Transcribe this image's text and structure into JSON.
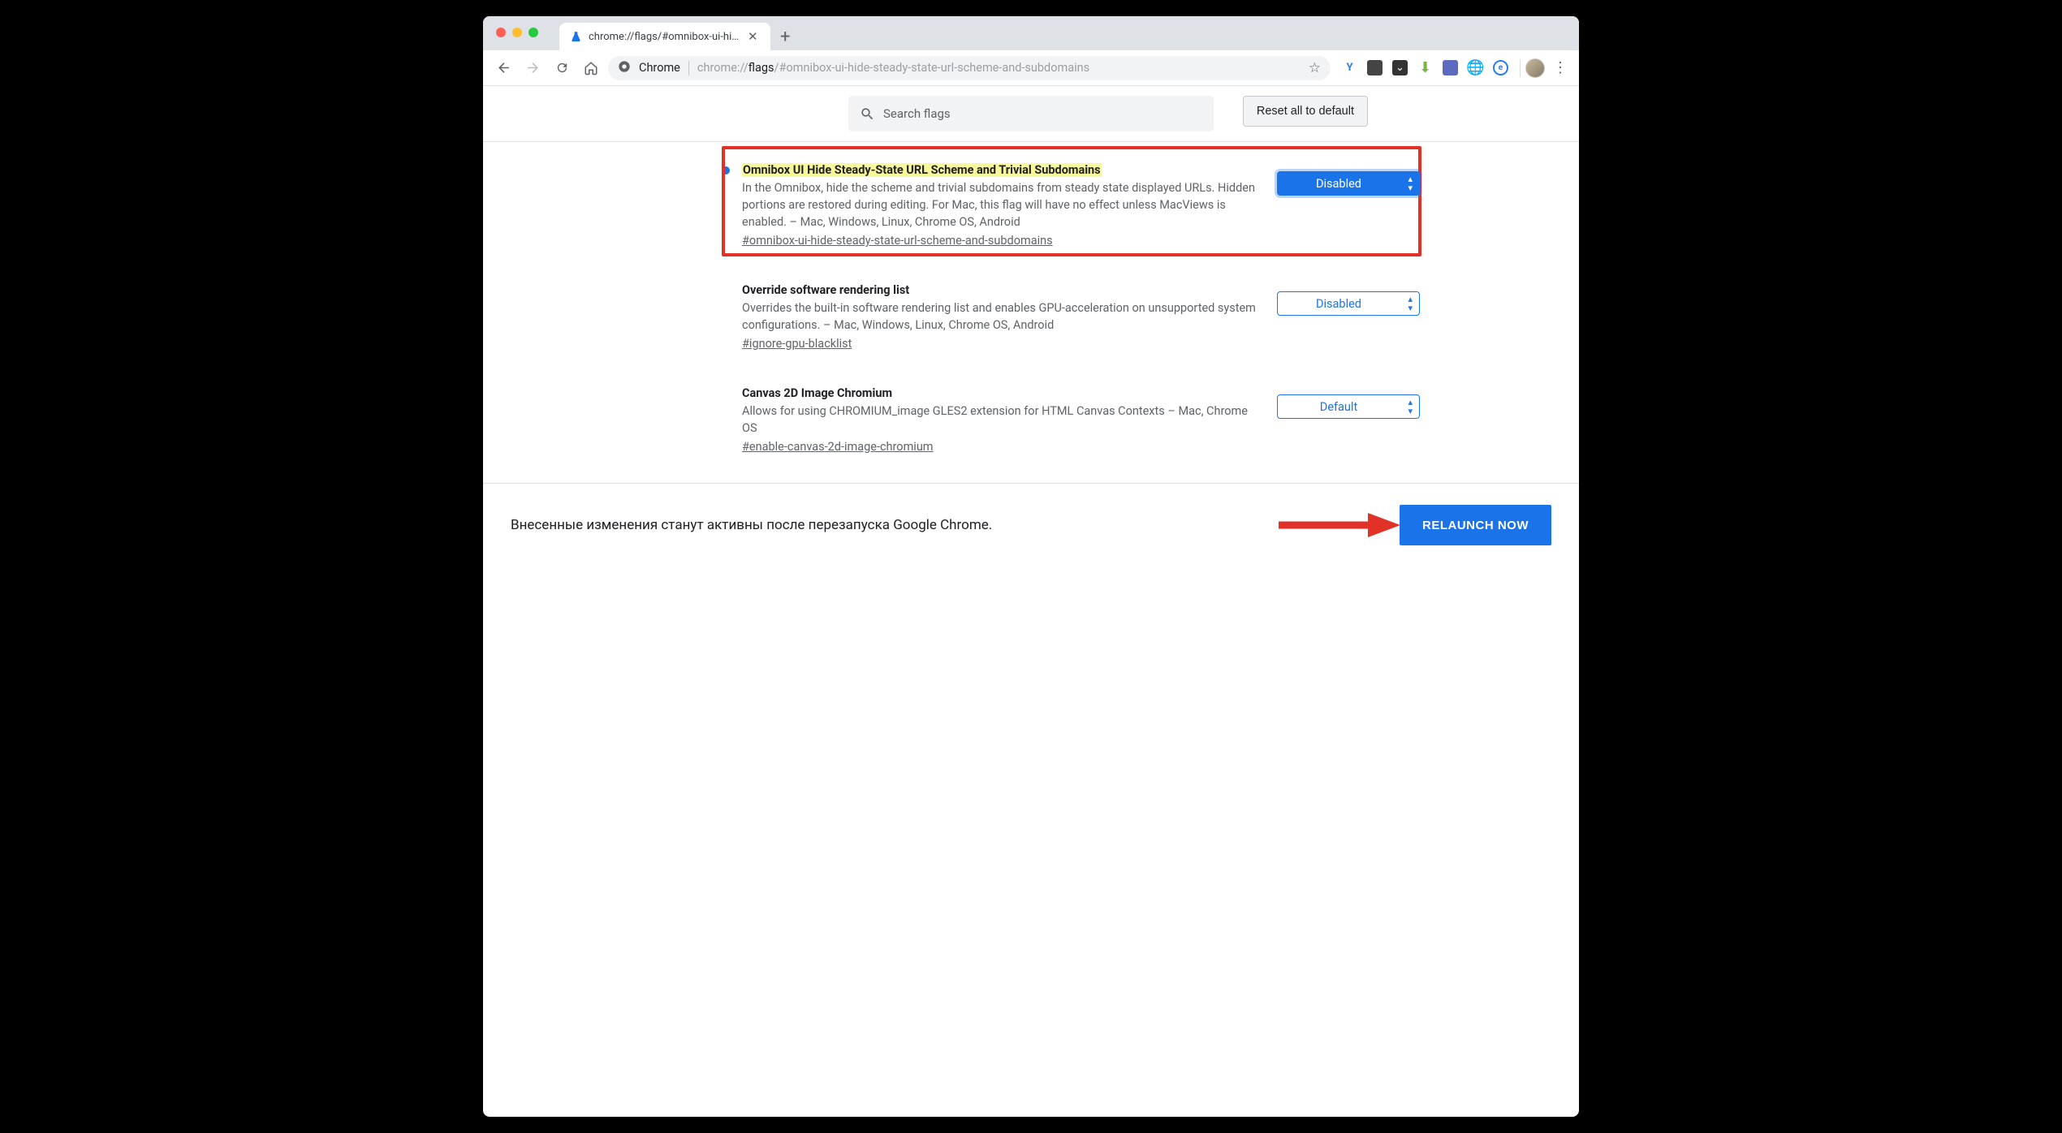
{
  "tab": {
    "title": "chrome://flags/#omnibox-ui-hi…"
  },
  "omnibox": {
    "chip": "Chrome",
    "url_scheme": "chrome://",
    "url_host": "flags",
    "url_rest": "/#omnibox-ui-hide-steady-state-url-scheme-and-subdomains"
  },
  "header": {
    "search_placeholder": "Search flags",
    "reset_label": "Reset all to default"
  },
  "flags": [
    {
      "highlighted": true,
      "dot": true,
      "title": "Omnibox UI Hide Steady-State URL Scheme and Trivial Subdomains",
      "desc": "In the Omnibox, hide the scheme and trivial subdomains from steady state displayed URLs. Hidden portions are restored during editing. For Mac, this flag will have no effect unless MacViews is enabled. – Mac, Windows, Linux, Chrome OS, Android",
      "anchor": "#omnibox-ui-hide-steady-state-url-scheme-and-subdomains",
      "value": "Disabled",
      "active_style": true
    },
    {
      "highlighted": false,
      "dot": false,
      "title": "Override software rendering list",
      "desc": "Overrides the built-in software rendering list and enables GPU-acceleration on unsupported system configurations. – Mac, Windows, Linux, Chrome OS, Android",
      "anchor": "#ignore-gpu-blacklist",
      "value": "Disabled",
      "active_style": false
    },
    {
      "highlighted": false,
      "dot": false,
      "title": "Canvas 2D Image Chromium",
      "desc": "Allows for using CHROMIUM_image GLES2 extension for HTML Canvas Contexts – Mac, Chrome OS",
      "anchor": "#enable-canvas-2d-image-chromium",
      "value": "Default",
      "active_style": false
    }
  ],
  "footer": {
    "message": "Внесенные изменения станут активны после перезапуска Google Chrome.",
    "relaunch": "RELAUNCH NOW"
  }
}
